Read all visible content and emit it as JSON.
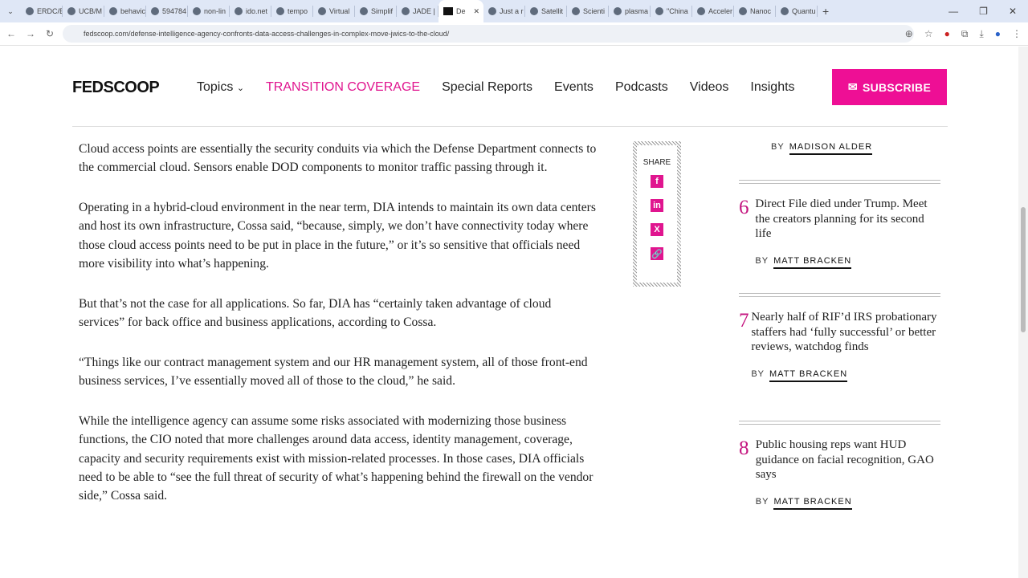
{
  "browser": {
    "tabs": [
      "ERDC/E",
      "UCB/M",
      "behavic",
      "594784",
      "non-lin",
      "ido.net",
      "tempo",
      "Virtual",
      "Simplif",
      "JADE |",
      "De",
      "Just a r",
      "Satellit",
      "Scienti",
      "plasma",
      "\"China",
      "Acceler",
      "Nanoc",
      "Quantu"
    ],
    "active_tab": 10,
    "url": "fedscoop.com/defense-intelligence-agency-confronts-data-access-challenges-in-complex-move-jwics-to-the-cloud/"
  },
  "header": {
    "logo": "FEDSCOOP",
    "nav": [
      "Topics",
      "TRANSITION COVERAGE",
      "Special Reports",
      "Events",
      "Podcasts",
      "Videos",
      "Insights"
    ],
    "subscribe": "SUBSCRIBE"
  },
  "article": {
    "paragraphs": [
      "Cloud access points are essentially the security conduits via which the Defense Department connects to the commercial cloud. Sensors enable DOD components to monitor traffic passing through it.",
      "Operating in a hybrid-cloud environment in the near term, DIA intends to maintain its own data centers and host its own infrastructure, Cossa said, “because, simply, we don’t have connectivity today where those cloud access points need to be put in place in the future,” or it’s so sensitive that officials need more visibility into what’s happening.",
      "But that’s not the case for all applications. So far, DIA has “certainly taken advantage of cloud services” for back office and business applications, according to Cossa.",
      "“Things like our contract management system and our HR management system, all of those front-end business services, I’ve essentially moved all of those to the cloud,” he said.",
      "While the intelligence agency can assume some risks associated with modernizing those business functions, the CIO noted that more challenges around data access, identity management, coverage, capacity and security requirements exist with mission-related processes. In those cases, DIA officials need to be able to “see the full threat of security of what’s happening behind the firewall on the vendor side,” Cossa said."
    ]
  },
  "share": {
    "label": "SHARE",
    "icons": [
      "f",
      "in",
      "X",
      "🔗"
    ]
  },
  "sidebar": {
    "by": "BY",
    "top_author": "MADISON ALDER",
    "items": [
      {
        "num": "6",
        "title": "Direct File died under Trump. Meet the creators planning for its second life",
        "author": "MATT BRACKEN"
      },
      {
        "num": "7",
        "title": "Nearly half of RIF’d IRS probationary staffers had ‘fully successful’ or better reviews, watchdog finds",
        "author": "MATT BRACKEN"
      },
      {
        "num": "8",
        "title": "Public housing reps want HUD guidance on facial recognition, GAO says",
        "author": "MATT BRACKEN"
      }
    ]
  }
}
